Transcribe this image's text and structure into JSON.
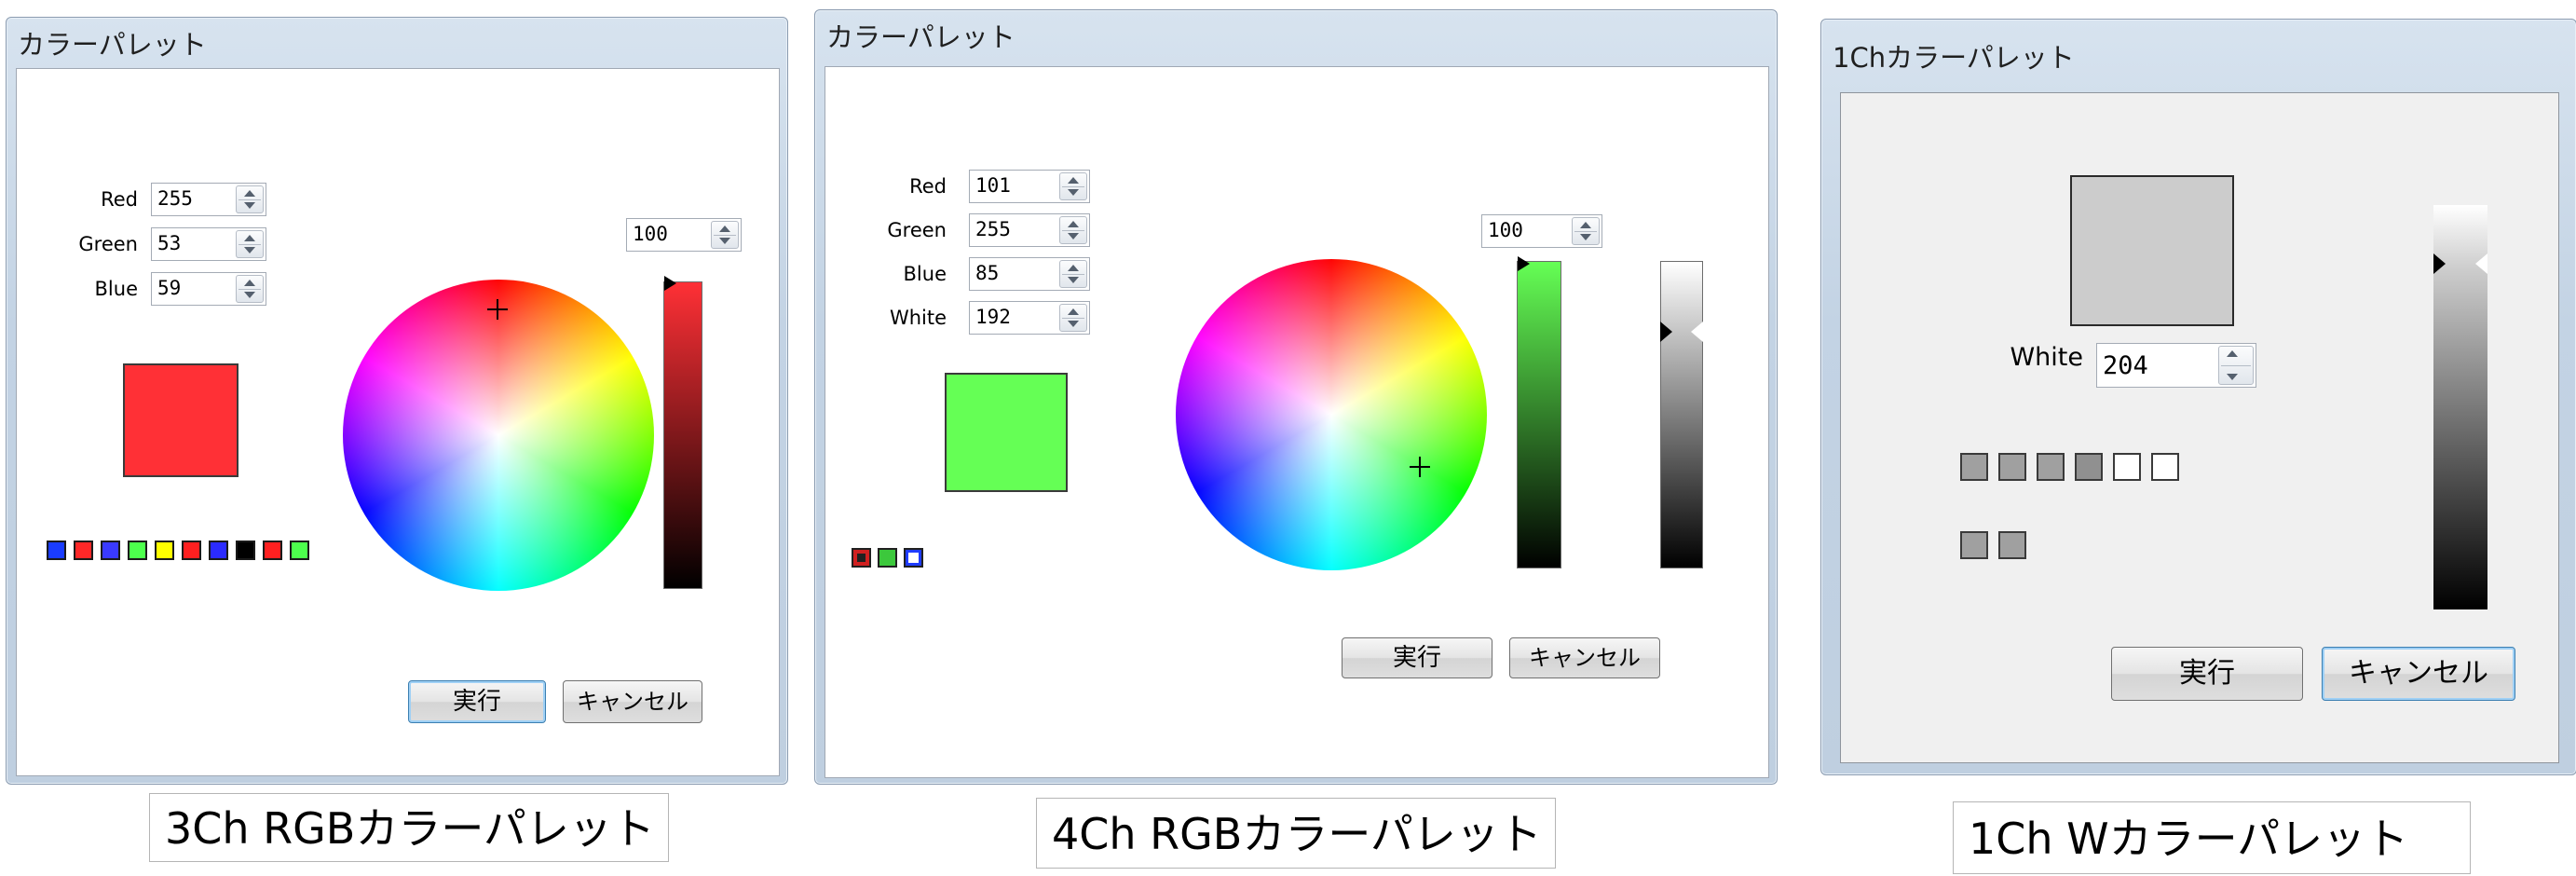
{
  "dialogs": [
    {
      "title": "カラーパレット",
      "fields": [
        {
          "label": "Red",
          "value": "255"
        },
        {
          "label": "Green",
          "value": "53"
        },
        {
          "label": "Blue",
          "value": "59"
        }
      ],
      "brightness_value": "100",
      "preview_color": "#ff3036",
      "swatches": [
        "#1a3cff",
        "#ff2828",
        "#3a3aff",
        "#4dff4d",
        "#ffff00",
        "#ff2020",
        "#2b2bff",
        "#000000",
        "#ff2020",
        "#4dff4d"
      ],
      "ok_label": "実行",
      "cancel_label": "キャンセル"
    },
    {
      "title": "カラーパレット",
      "fields": [
        {
          "label": "Red",
          "value": "101"
        },
        {
          "label": "Green",
          "value": "255"
        },
        {
          "label": "Blue",
          "value": "85"
        },
        {
          "label": "White",
          "value": "192"
        }
      ],
      "brightness_value": "100",
      "preview_color": "#65ff55",
      "swatches": [
        "#d02020",
        "#3cc83c",
        "#ffffff"
      ],
      "ok_label": "実行",
      "cancel_label": "キャンセル"
    },
    {
      "title": "1Chカラーパレット",
      "fields": [
        {
          "label": "White",
          "value": "204"
        }
      ],
      "preview_color": "#cccccc",
      "swatch_row1": [
        "#a0a0a0",
        "#a0a0a0",
        "#a0a0a0",
        "#909090",
        "#ffffff",
        "#ffffff"
      ],
      "swatch_row2": [
        "#a0a0a0",
        "#a0a0a0"
      ],
      "ok_label": "実行",
      "cancel_label": "キャンセル"
    }
  ],
  "captions": [
    "3Ch RGBカラーパレット",
    "4Ch RGBカラーパレット",
    "1Ch Wカラーパレット"
  ]
}
